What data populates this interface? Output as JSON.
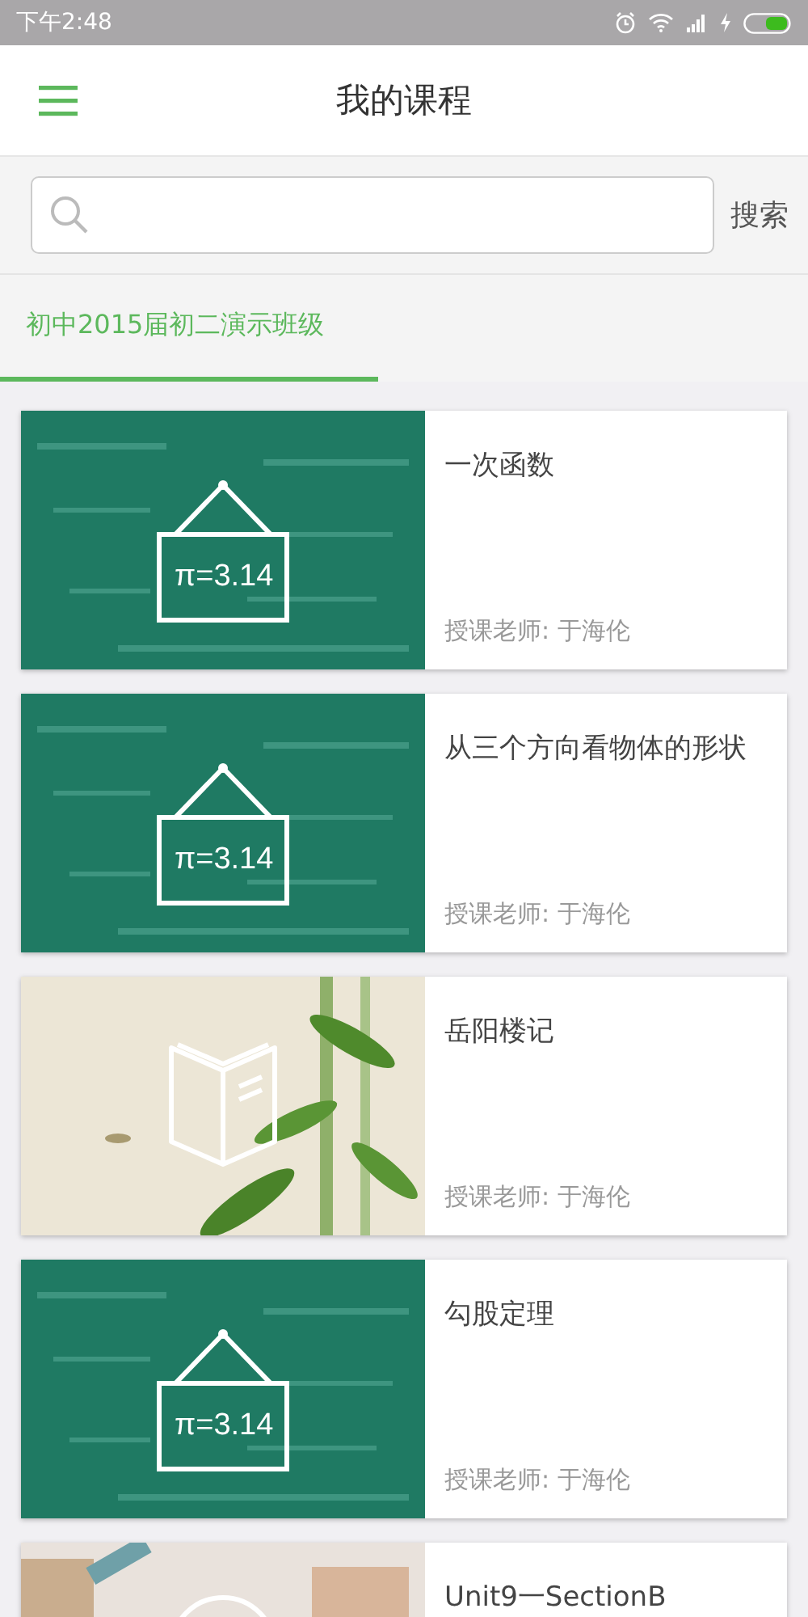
{
  "status_bar": {
    "time": "下午2:48"
  },
  "header": {
    "title": "我的课程"
  },
  "search": {
    "button": "搜索"
  },
  "tabs": [
    {
      "label": "初中2015届初二演示班级",
      "selected": true
    }
  ],
  "courses": [
    {
      "kind": "math",
      "icon_text": "π=3.14",
      "title": "一次函数",
      "teacher": "授课老师: 于海伦"
    },
    {
      "kind": "math",
      "icon_text": "π=3.14",
      "title": "从三个方向看物体的形状",
      "teacher": "授课老师: 于海伦"
    },
    {
      "kind": "book",
      "title": "岳阳楼记",
      "teacher": "授课老师: 于海伦"
    },
    {
      "kind": "math",
      "icon_text": "π=3.14",
      "title": "勾股定理",
      "teacher": "授课老师: 于海伦"
    },
    {
      "kind": "letters",
      "title": "Unit9一SectionB"
    }
  ]
}
